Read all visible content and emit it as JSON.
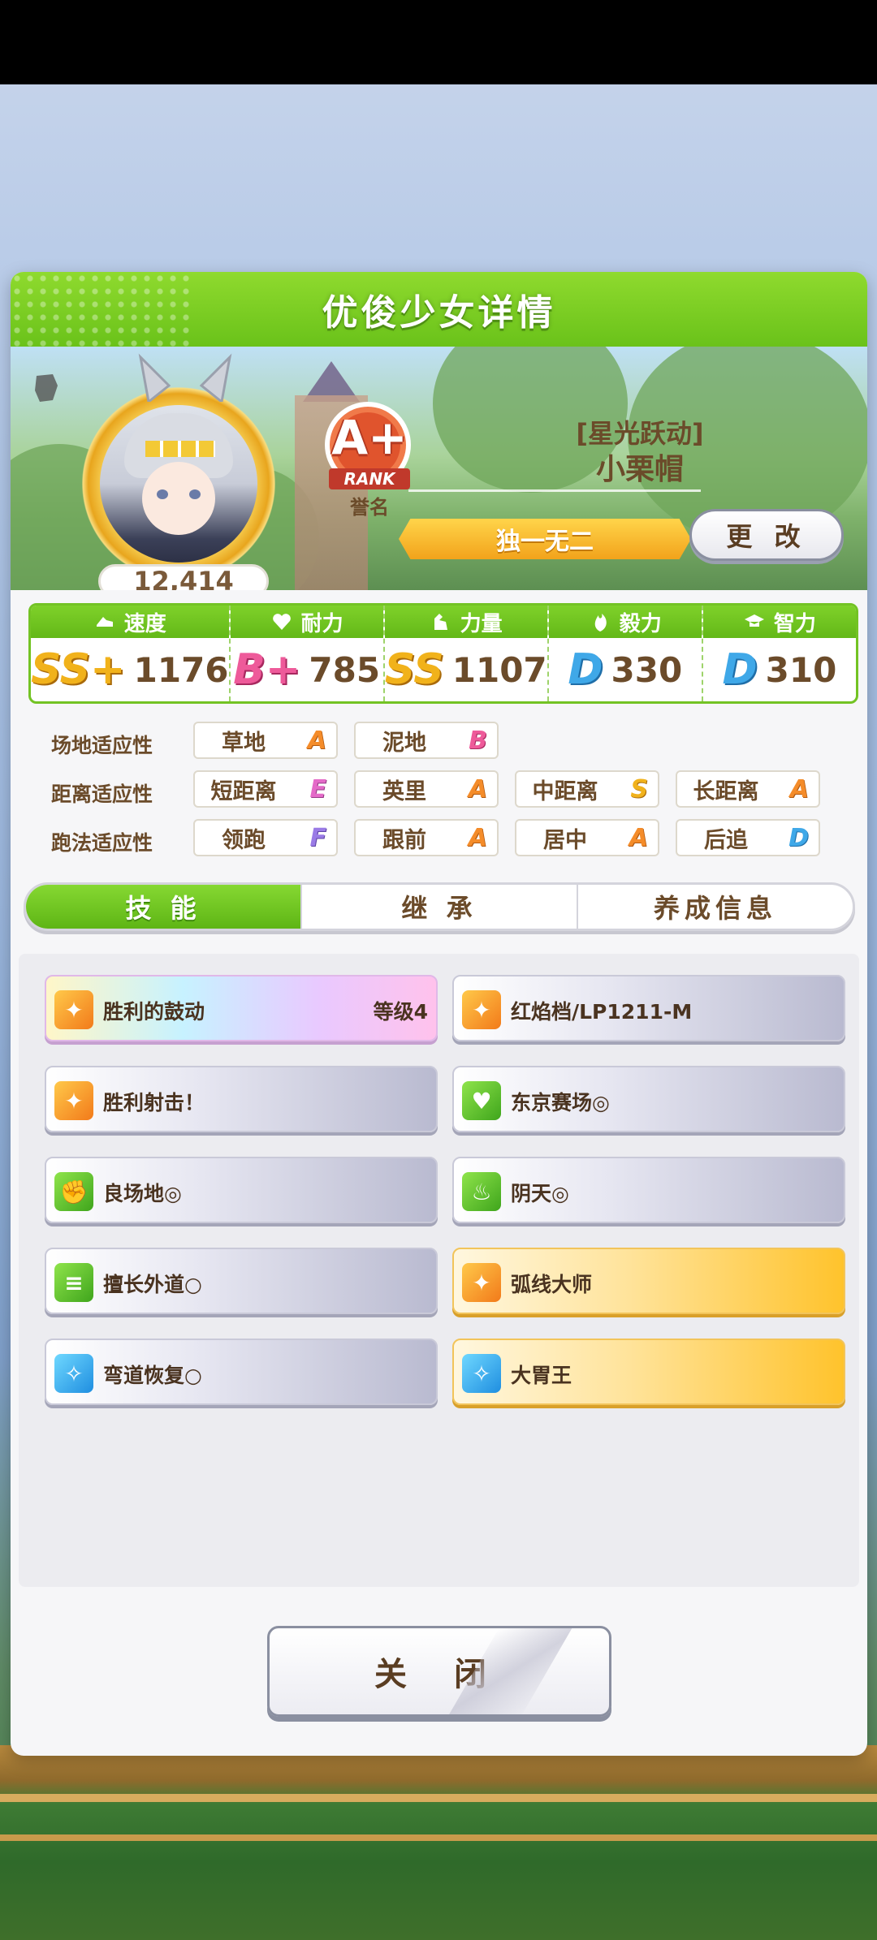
{
  "header": {
    "title": "优俊少女详情"
  },
  "profile": {
    "score": "12,414",
    "rank": {
      "grade": "A+",
      "label": "RANK",
      "caption": "誉名"
    },
    "epithet": "[星光跃动]",
    "name": "小栗帽",
    "title": "独一无二",
    "change_label": "更 改"
  },
  "stats": [
    {
      "label": "速度",
      "grade": "SS+",
      "value": "1176",
      "icon": "speed-shoe-icon"
    },
    {
      "label": "耐力",
      "grade": "B+",
      "value": "785",
      "icon": "heart-icon"
    },
    {
      "label": "力量",
      "grade": "SS",
      "value": "1107",
      "icon": "muscle-icon"
    },
    {
      "label": "毅力",
      "grade": "D",
      "value": "330",
      "icon": "flame-icon"
    },
    {
      "label": "智力",
      "grade": "D",
      "value": "310",
      "icon": "graduation-cap-icon"
    }
  ],
  "aptitude": {
    "surface": {
      "label": "场地适应性",
      "items": [
        {
          "name": "草地",
          "grade": "A"
        },
        {
          "name": "泥地",
          "grade": "B"
        }
      ]
    },
    "distance": {
      "label": "距离适应性",
      "items": [
        {
          "name": "短距离",
          "grade": "E"
        },
        {
          "name": "英里",
          "grade": "A"
        },
        {
          "name": "中距离",
          "grade": "S"
        },
        {
          "name": "长距离",
          "grade": "A"
        }
      ]
    },
    "strategy": {
      "label": "跑法适应性",
      "items": [
        {
          "name": "领跑",
          "grade": "F"
        },
        {
          "name": "跟前",
          "grade": "A"
        },
        {
          "name": "居中",
          "grade": "A"
        },
        {
          "name": "后追",
          "grade": "D"
        }
      ]
    }
  },
  "tabs": [
    {
      "label": "技 能"
    },
    {
      "label": "继 承"
    },
    {
      "label": "养成信息"
    }
  ],
  "skills": [
    {
      "name": "胜利的鼓动",
      "level": "等级4",
      "icon": "running-horse-icon"
    },
    {
      "name": "红焰档/LP1211-M",
      "icon": "running-horse-icon"
    },
    {
      "name": "胜利射击！",
      "icon": "running-horse-icon"
    },
    {
      "name": "东京赛场◎",
      "icon": "heart-icon"
    },
    {
      "name": "良场地◎",
      "icon": "muscle-icon"
    },
    {
      "name": "阴天◎",
      "icon": "flame-icon"
    },
    {
      "name": "擅长外道○",
      "icon": "lane-icon"
    },
    {
      "name": "弧线大师",
      "icon": "running-horse-icon"
    },
    {
      "name": "弯道恢复○",
      "icon": "sparkle-icon"
    },
    {
      "name": "大胃王",
      "icon": "sparkle-icon"
    }
  ],
  "close_label": "关 闭"
}
